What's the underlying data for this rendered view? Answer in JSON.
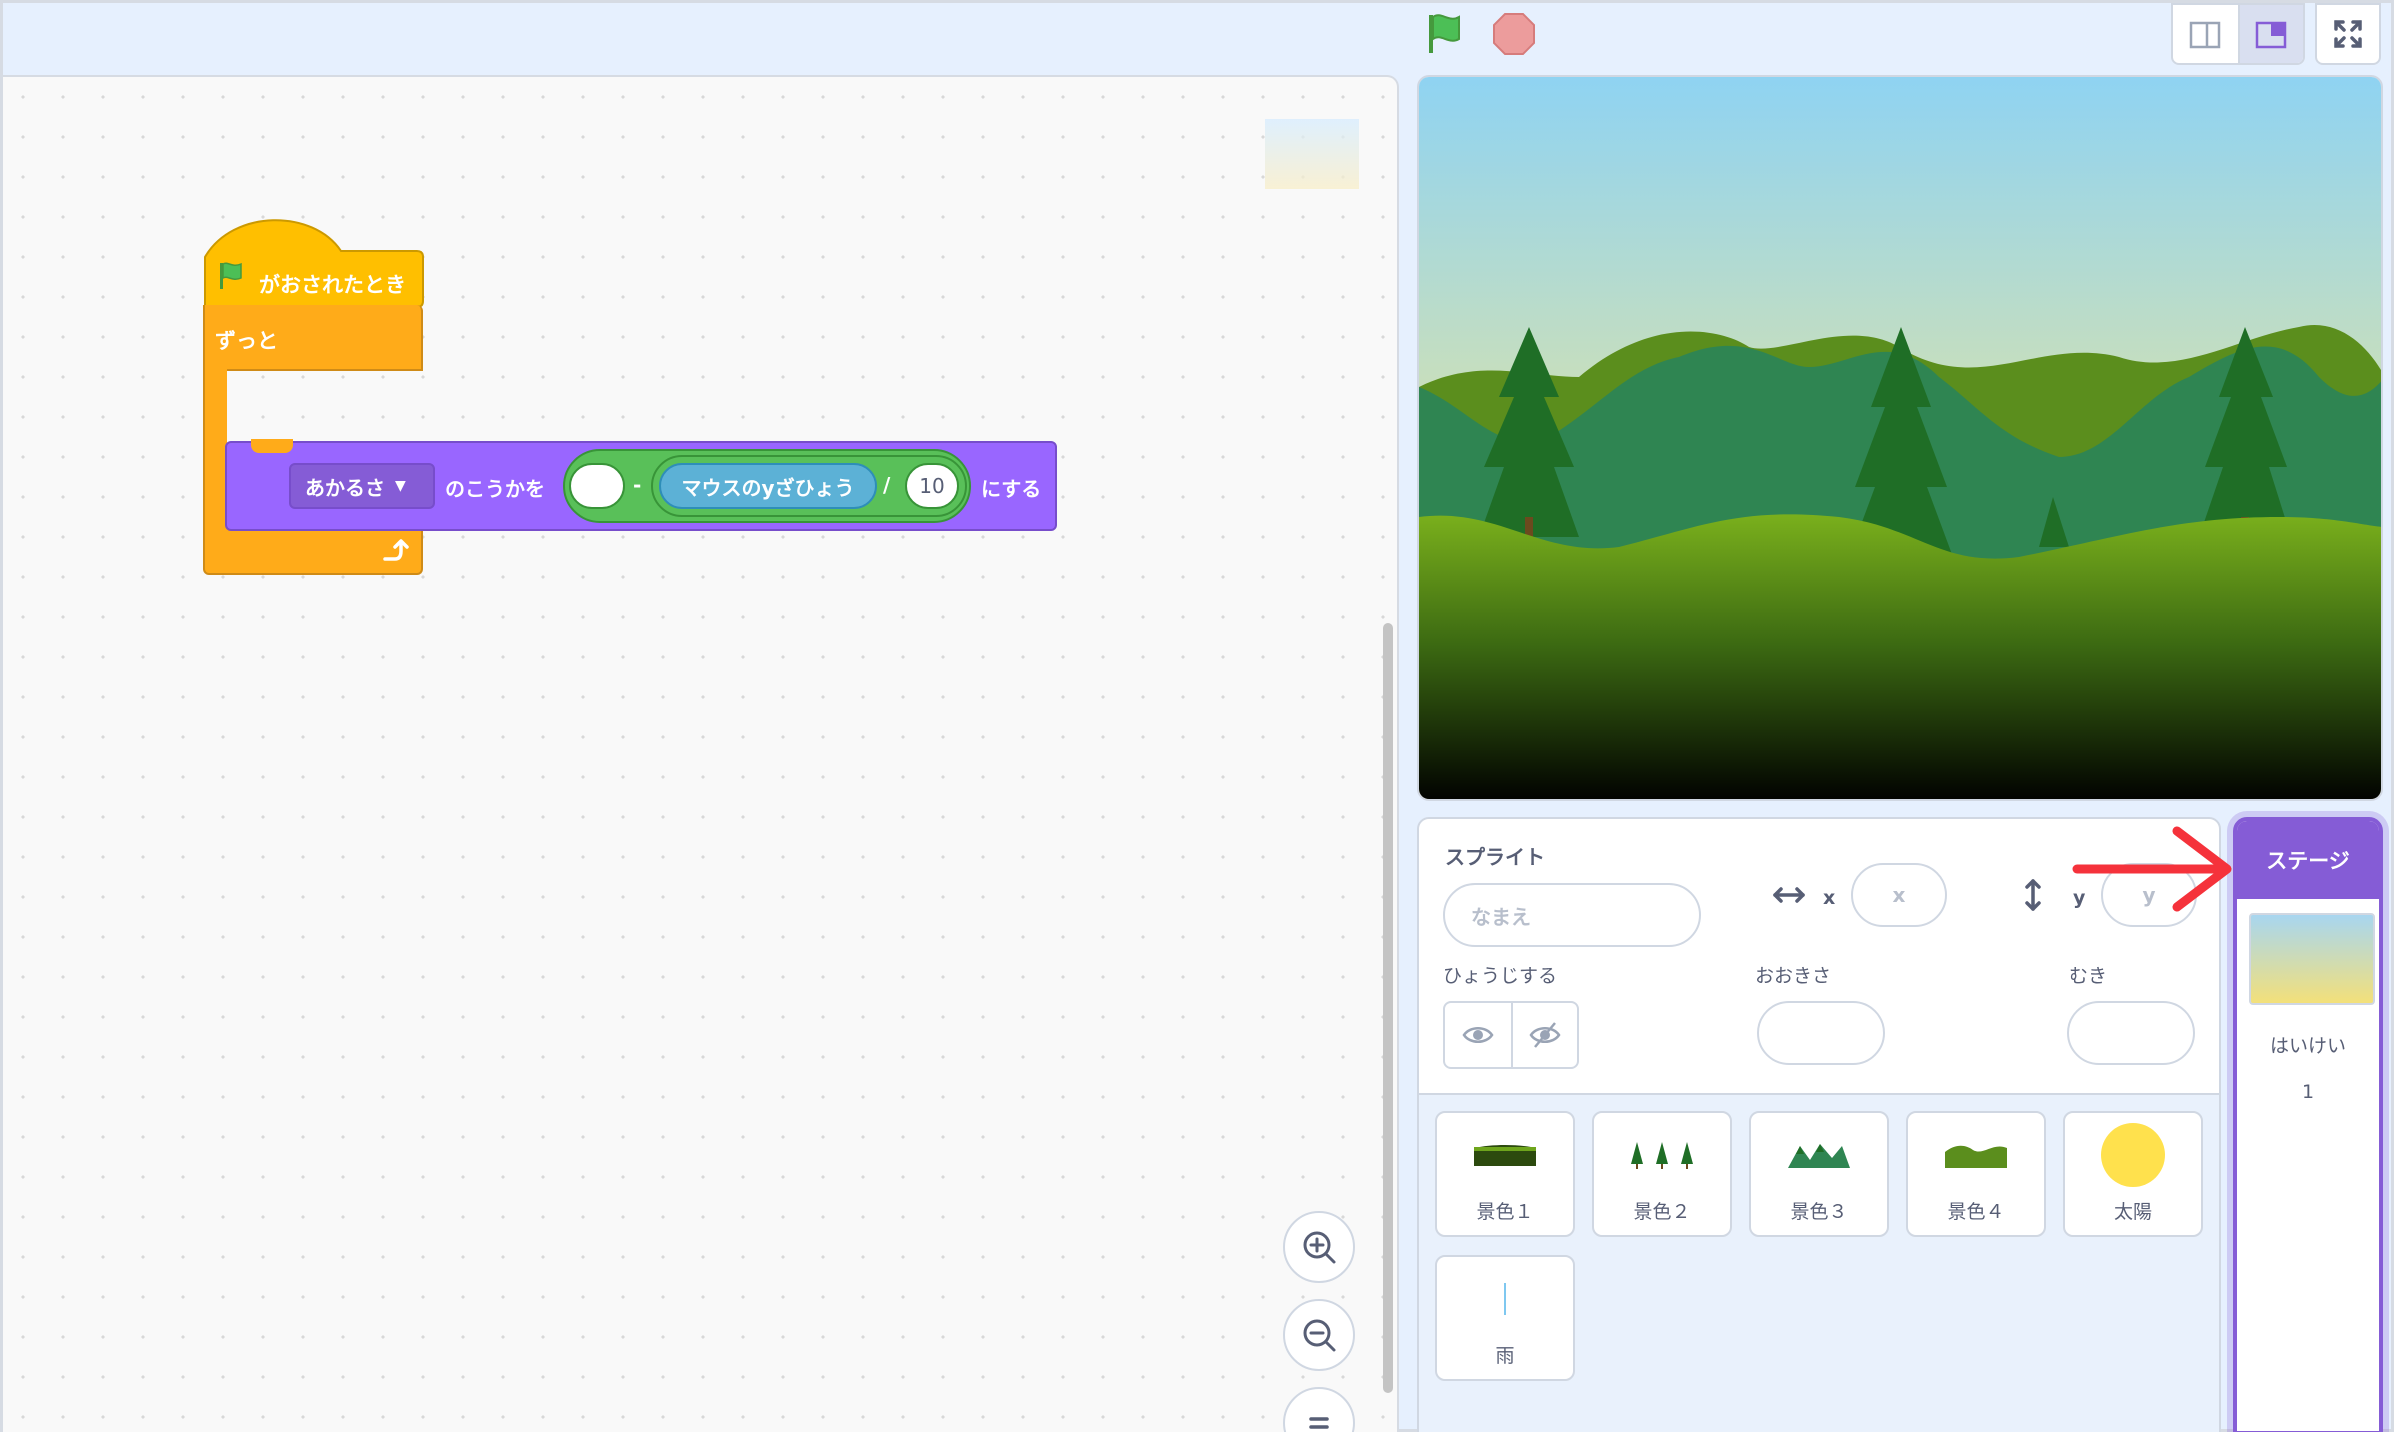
{
  "toolbar": {
    "green_flag_icon": "green-flag-icon",
    "stop_icon": "stop-sign-icon",
    "layout_small_icon": "small-stage-icon",
    "layout_normal_icon": "normal-stage-icon",
    "fullscreen_icon": "fullscreen-icon"
  },
  "script": {
    "hat_label": "がおされたとき",
    "forever_label": "ずっと",
    "set_dropdown": "あかるさ",
    "set_middle": "のこうかを",
    "minus": "-",
    "sensing_label": "マウスのyざひょう",
    "divide": "/",
    "divisor": "10",
    "set_end": "にする"
  },
  "sprite_info": {
    "title": "スプライト",
    "name_placeholder": "なまえ",
    "x_label": "x",
    "x_placeholder": "x",
    "y_label": "y",
    "y_placeholder": "y",
    "show_label": "ひょうじする",
    "size_label": "おおきさ",
    "direction_label": "むき"
  },
  "sprites": [
    {
      "name": "景色１",
      "icon": "landscape-1-icon"
    },
    {
      "name": "景色２",
      "icon": "trees-icon"
    },
    {
      "name": "景色３",
      "icon": "mountains-icon"
    },
    {
      "name": "景色４",
      "icon": "hills-icon"
    },
    {
      "name": "太陽",
      "icon": "sun-icon"
    },
    {
      "name": "雨",
      "icon": "rain-icon"
    }
  ],
  "stage_selector": {
    "header": "ステージ",
    "backdrop_label": "はいけい",
    "backdrop_count": "1"
  },
  "colors": {
    "events": "#ffc629",
    "control": "#ffab19",
    "looks": "#9966ff",
    "operators": "#59c059",
    "sensing": "#5cb1d6",
    "accent": "#855cd6",
    "annotation_arrow": "#f5323b"
  }
}
